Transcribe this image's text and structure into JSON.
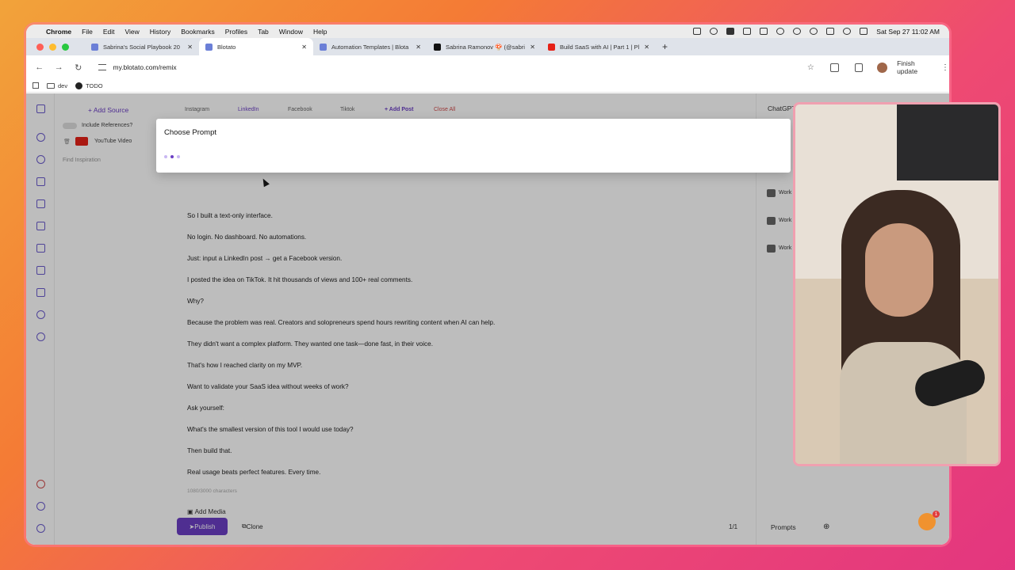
{
  "menubar": {
    "app": "Chrome",
    "items": [
      "File",
      "Edit",
      "View",
      "History",
      "Bookmarks",
      "Profiles",
      "Tab",
      "Window",
      "Help"
    ],
    "datetime": "Sat Sep 27  11:02 AM"
  },
  "tabs": [
    {
      "title": "Sabrina's Social Playbook 20",
      "favicon_color": "#6b7fd7"
    },
    {
      "title": "Blotato",
      "favicon_color": "#6b7fd7"
    },
    {
      "title": "Automation Templates | Blota",
      "favicon_color": "#6b7fd7"
    },
    {
      "title": "Sabrina Ramonov 🍄 (@sabri",
      "favicon_color": "#111111"
    },
    {
      "title": "Build SaaS with AI | Part 1 | Pl",
      "favicon_color": "#e62117"
    }
  ],
  "toolbar": {
    "url": "my.blotato.com/remix",
    "finish_update": "Finish update"
  },
  "bookmarks": [
    "dev",
    "TODO"
  ],
  "sidebar": {
    "add_source": "+ Add Source",
    "include_references": "Include References?",
    "youtube_video": "YouTube Video",
    "find_inspiration": "Find Inspiration"
  },
  "platform_tabs": [
    "Instagram",
    "LinkedIn",
    "Facebook",
    "Tiktok"
  ],
  "add_post": "+ Add Post",
  "close_all": "Close All",
  "post_lines": [
    "So I built a text-only interface.",
    "No login. No dashboard. No automations.",
    "Just: input a LinkedIn post → get a Facebook version.",
    "I posted the idea on TikTok. It hit thousands of views and 100+ real comments.",
    "Why?",
    "Because the problem was real. Creators and solopreneurs spend hours rewriting content when AI can help.",
    "They didn't want a complex platform. They wanted one task—done fast, in their voice.",
    "That's how I reached clarity on my MVP.",
    "Want to validate your SaaS idea without weeks of work?",
    "Ask yourself:",
    "What's the smallest version of this tool I would use today?",
    "Then build that.",
    "Real usage beats perfect features. Every time."
  ],
  "char_count": "1080/3000 characters",
  "add_media": "Add Media",
  "publish": "Publish",
  "clone": "Clone",
  "page_indicator": "1/1",
  "prompts_label": "Prompts",
  "chatgpt_label": "ChatGPT",
  "modal": {
    "title": "Choose Prompt",
    "loading_dots": [
      "#c9b8f2",
      "#6b3fc4",
      "#c9b8f2"
    ]
  },
  "right_items": [
    "Work",
    "Work",
    "Work"
  ],
  "chat_badge": "1",
  "colors": {
    "accent": "#6b3fc4",
    "window_border": "#f0a0b0"
  }
}
